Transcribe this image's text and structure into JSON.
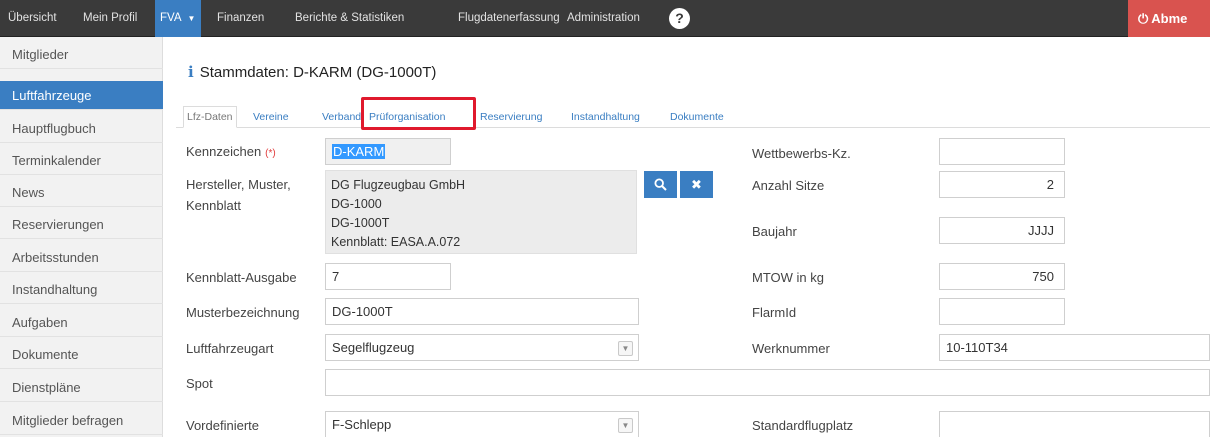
{
  "topnav": {
    "items": [
      "Übersicht",
      "Mein Profil",
      "FVA",
      "Finanzen",
      "Berichte & Statistiken",
      "Flugdatenerfassung",
      "Administration"
    ],
    "help_icon": "?",
    "logout_label": "Abme"
  },
  "sidebar": {
    "items": [
      "Mitglieder",
      "Luftfahrzeuge",
      "Hauptflugbuch",
      "Terminkalender",
      "News",
      "Reservierungen",
      "Arbeitsstunden",
      "Instandhaltung",
      "Aufgaben",
      "Dokumente",
      "Dienstpläne",
      "Mitglieder befragen"
    ],
    "active_index": 1
  },
  "page": {
    "title": "Stammdaten: D-KARM (DG-1000T)"
  },
  "tabs": {
    "items": [
      "Lfz-Daten",
      "Vereine",
      "Verband",
      "Prüforganisation",
      "Reservierung",
      "Instandhaltung",
      "Dokumente"
    ],
    "active_index": 0,
    "highlighted_index": 3
  },
  "form": {
    "kennzeichen_label": "Kennzeichen",
    "required_mark": "(*)",
    "kennzeichen_value": "D-KARM",
    "hersteller_label_1": "Hersteller, Muster,",
    "hersteller_label_2": "Kennblatt",
    "hersteller_lines": [
      "DG Flugzeugbau GmbH",
      "DG-1000",
      "DG-1000T",
      "Kennblatt: EASA.A.072"
    ],
    "kennblatt_ausgabe_label": "Kennblatt-Ausgabe",
    "kennblatt_ausgabe_value": "7",
    "musterbezeichnung_label": "Musterbezeichnung",
    "musterbezeichnung_value": "DG-1000T",
    "luftfahrzeugart_label": "Luftfahrzeugart",
    "luftfahrzeugart_value": "Segelflugzeug",
    "spot_label": "Spot",
    "spot_value": "",
    "vordefinierte_label": "Vordefinierte",
    "vordefinierte_value": "F-Schlepp",
    "wettbewerbs_label": "Wettbewerbs-Kz.",
    "wettbewerbs_value": "",
    "anzahl_sitze_label": "Anzahl Sitze",
    "anzahl_sitze_value": "2",
    "baujahr_label": "Baujahr",
    "baujahr_value": "JJJJ",
    "mtow_label": "MTOW in kg",
    "mtow_value": "750",
    "flarmid_label": "FlarmId",
    "flarmid_value": "",
    "werknummer_label": "Werknummer",
    "werknummer_value": "10-110T34",
    "standardflugplatz_label": "Standardflugplatz",
    "standardflugplatz_value": ""
  },
  "colors": {
    "accent": "#3a7ec2",
    "navbar": "#3a3a3a",
    "logout": "#d9534f",
    "highlight": "#e0192d"
  },
  "icons": {
    "search": "search-icon",
    "clear": "close-icon",
    "help": "question-circle-icon",
    "power": "power-icon",
    "info": "info-icon",
    "dropdown": "chevron-down-icon"
  }
}
